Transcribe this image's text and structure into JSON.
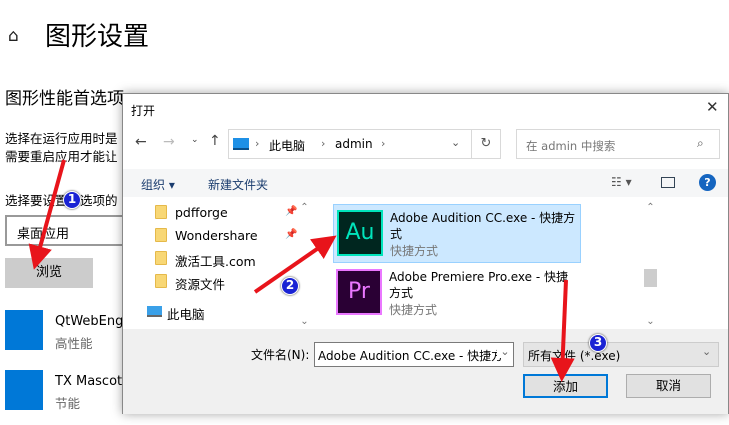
{
  "header": {
    "home_icon": "home-icon",
    "title": "图形设置"
  },
  "section": {
    "title": "图形性能首选项",
    "desc1": "选择在运行应用时是",
    "desc2": "需要重启应用才能让",
    "pick_label": "选择要设置首选项的",
    "app_type": "桌面应用",
    "browse": "浏览"
  },
  "apps": [
    {
      "name": "QtWebEngi",
      "pref": "高性能"
    },
    {
      "name": "TX Mascot.",
      "pref": "节能"
    }
  ],
  "dialog": {
    "title": "打开",
    "close": "✕",
    "address": {
      "crumbs": [
        "此电脑",
        "admin"
      ]
    },
    "search_placeholder": "在 admin 中搜索",
    "toolbar": {
      "organize": "组织 ▾",
      "new_folder": "新建文件夹"
    },
    "nav": [
      "pdfforge",
      "Wondershare",
      "激活工具.com",
      "资源文件",
      "此电脑"
    ],
    "files": [
      {
        "name1": "Adobe Audition CC.exe - 快捷方",
        "name2": "式",
        "type": "快捷方式",
        "icon": "Au",
        "color": "#00e4bb",
        "bg": "#00261f"
      },
      {
        "name1": "Adobe Premiere Pro.exe - 快捷",
        "name2": "方式",
        "type": "快捷方式",
        "icon": "Pr",
        "color": "#ea77ff",
        "bg": "#2a0034"
      }
    ],
    "filename_label": "文件名(N):",
    "filename_value": "Adobe Audition CC.exe - 快捷方",
    "filter": "所有文件 (*.exe)",
    "add": "添加",
    "cancel": "取消"
  },
  "badges": [
    "1",
    "2",
    "3"
  ],
  "colors": {
    "accent": "#0078d7",
    "arrow": "#e8141b",
    "badge": "#1a23d4"
  }
}
